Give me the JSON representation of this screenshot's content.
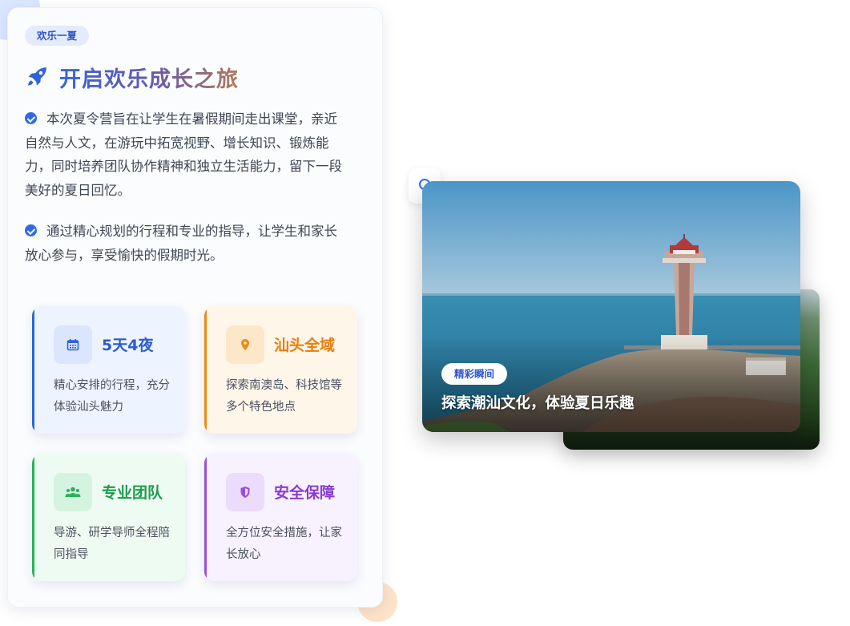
{
  "intro": {
    "badge": "欢乐一夏",
    "title": "开启欢乐成长之旅",
    "paragraphs": [
      "本次夏令营旨在让学生在暑假期间走出课堂，亲近自然与人文，在游玩中拓宽视野、增长知识、锻炼能力，同时培养团队协作精神和独立生活能力，留下一段美好的夏日回忆。",
      "通过精心规划的行程和专业的指导，让学生和家长放心参与，享受愉快的假期时光。"
    ]
  },
  "features": [
    {
      "title": "5天4夜",
      "desc": "精心安排的行程，充分体验汕头魅力",
      "icon": "calendar-icon",
      "color": "#2a64dd"
    },
    {
      "title": "汕头全域",
      "desc": "探索南澳岛、科技馆等多个特色地点",
      "icon": "map-pin-icon",
      "color": "#f08a16"
    },
    {
      "title": "专业团队",
      "desc": "导游、研学导师全程陪同指导",
      "icon": "users-icon",
      "color": "#26b35c"
    },
    {
      "title": "安全保障",
      "desc": "全方位安全措施，让家长放心",
      "icon": "shield-icon",
      "color": "#9a4fd9"
    }
  ],
  "gallery": {
    "tag": "精彩瞬间",
    "caption": "探索潮汕文化，体验夏日乐趣"
  }
}
